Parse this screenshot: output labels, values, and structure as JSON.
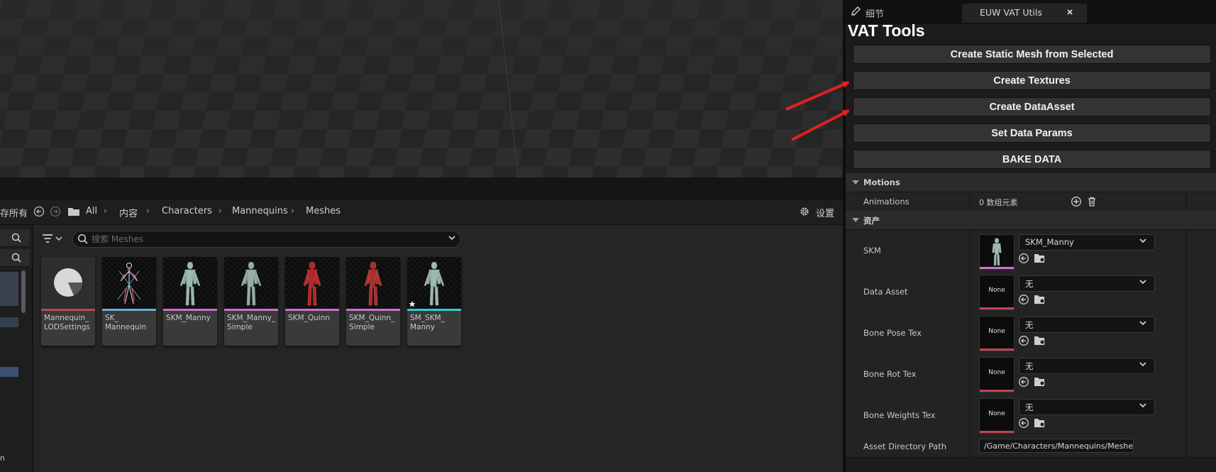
{
  "breadcrumb": {
    "cut_label": "存所有",
    "items": [
      "All",
      "内容",
      "Characters",
      "Mannequins",
      "Meshes"
    ],
    "settings_label": "设置"
  },
  "search": {
    "placeholder": "搜索 Meshes"
  },
  "assets": [
    {
      "label": "Mannequin_\nLODSettings",
      "stripe": "#c04454"
    },
    {
      "label": "SK_\nMannequin",
      "stripe": "#6fb0d8"
    },
    {
      "label": "SKM_Manny",
      "stripe": "#d070d0"
    },
    {
      "label": "SKM_Manny_\nSimple",
      "stripe": "#d070d0"
    },
    {
      "label": "SKM_Quinn",
      "stripe": "#d070d0"
    },
    {
      "label": "SKM_Quinn_\nSimple",
      "stripe": "#d070d0"
    },
    {
      "label": "SM_SKM_\nManny",
      "stripe": "#2fd0d0"
    }
  ],
  "panel": {
    "details_tab": "细节",
    "tool_tab": "EUW VAT Utils",
    "title": "VAT Tools",
    "buttons": {
      "create_static_mesh": "Create Static Mesh from Selected",
      "create_textures": "Create Textures",
      "create_data_asset": "Create DataAsset",
      "set_data_params": "Set Data Params",
      "bake_data": "BAKE DATA"
    },
    "motions_section": "Motions",
    "animations_label": "Animations",
    "animations_value": "0 数组元素",
    "assets_section": "资产",
    "rows": {
      "skm": {
        "label": "SKM",
        "value": "SKM_Manny"
      },
      "data_asset": {
        "label": "Data Asset",
        "value": "无",
        "thumb": "None"
      },
      "bone_pose_tex": {
        "label": "Bone Pose Tex",
        "value": "无",
        "thumb": "None"
      },
      "bone_rot_tex": {
        "label": "Bone Rot Tex",
        "value": "无",
        "thumb": "None"
      },
      "bone_weights_tex": {
        "label": "Bone Weights Tex",
        "value": "无",
        "thumb": "None"
      }
    },
    "asset_dir_label": "Asset Directory Path",
    "asset_dir_value": "/Game/Characters/Mannequins/Meshes"
  },
  "colors": {
    "annotation_arrow": "#e02020",
    "asset_stripe": "#c04454"
  }
}
